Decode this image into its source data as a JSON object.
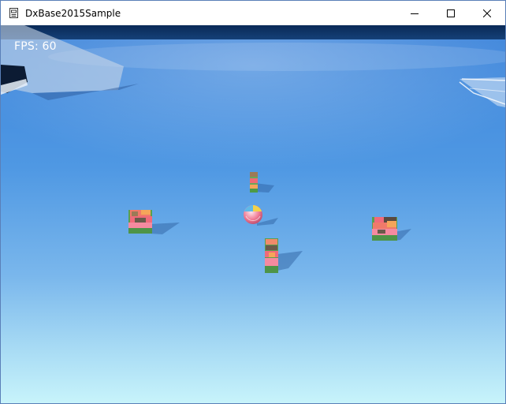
{
  "window": {
    "title": "DxBase2015Sample",
    "controls": {
      "minimize": "minimize-icon",
      "maximize": "maximize-icon",
      "close": "close-icon"
    }
  },
  "hud": {
    "fps_text": "FPS: 60"
  },
  "scene": {
    "sky_color": "#0a2a57",
    "floor_colors": [
      "#3f86db",
      "#5aa3e8",
      "#8fc6f0",
      "#c8f4fb"
    ],
    "objects": [
      "ball",
      "block-stack-north",
      "block-stack-west",
      "block-stack-south",
      "block-stack-east"
    ]
  }
}
